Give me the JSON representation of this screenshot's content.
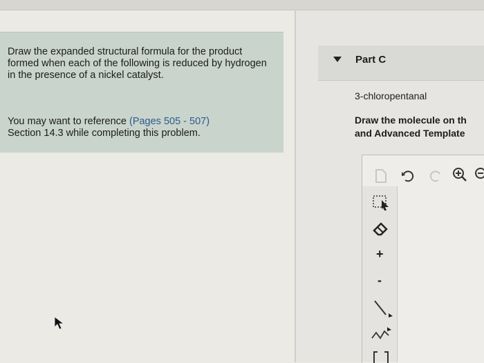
{
  "instructions_panel": {
    "prompt": "Draw the expanded structural formula for the product formed when each of the following is reduced by hydrogen in the presence of a nickel catalyst.",
    "reference_prefix": "You may want to reference ",
    "reference_link": "(Pages 505 - 507)",
    "reference_suffix": "Section 14.3 while completing this problem."
  },
  "part": {
    "title": "Part C",
    "compound": "3-chloropentanal",
    "draw_instructions_line1": "Draw the molecule on th",
    "draw_instructions_line2": "and Advanced Template"
  },
  "toolbar_top": [
    "new-document-icon",
    "undo-icon",
    "redo-icon",
    "zoom-in-icon",
    "zoom-out-icon"
  ],
  "toolbar_side": [
    "select-icon",
    "eraser-icon",
    "plus-charge-icon",
    "minus-charge-icon",
    "single-bond-icon",
    "chain-icon",
    "bracket-icon"
  ],
  "side_tools": {
    "plus": "+",
    "minus": "-"
  },
  "colors": {
    "panel": "#c9d4cc",
    "link": "#2d5b8c",
    "background": "#e9e8e3"
  }
}
